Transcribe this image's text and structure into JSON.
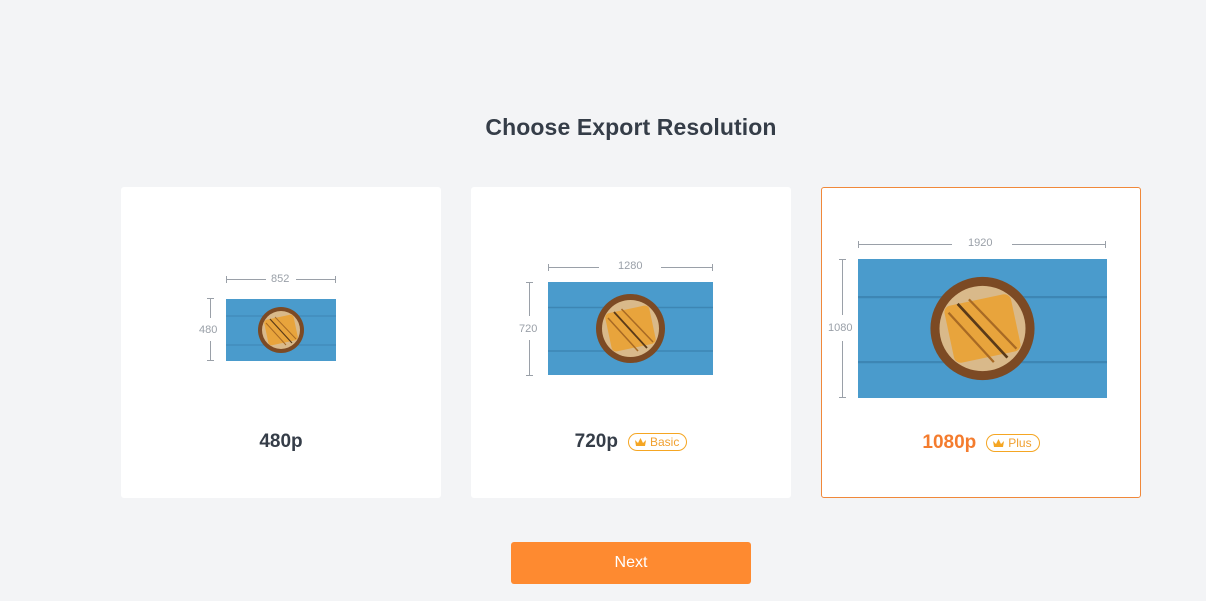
{
  "page": {
    "title": "Choose Export Resolution"
  },
  "options": [
    {
      "label": "480p",
      "width": "852",
      "height": "480",
      "badge": ""
    },
    {
      "label": "720p",
      "width": "1280",
      "height": "720",
      "badge": "Basic"
    },
    {
      "label": "1080p",
      "width": "1920",
      "height": "1080",
      "badge": "Plus"
    }
  ],
  "selected_option": "1080p",
  "actions": {
    "next_label": "Next"
  },
  "colors": {
    "accent": "#fe8a30",
    "badge": "#f5a623",
    "text": "#353d48",
    "background": "#f3f4f6"
  },
  "icons": {
    "badge_icon": "crown-icon",
    "thumbnail": "sandwich-plate-image"
  }
}
